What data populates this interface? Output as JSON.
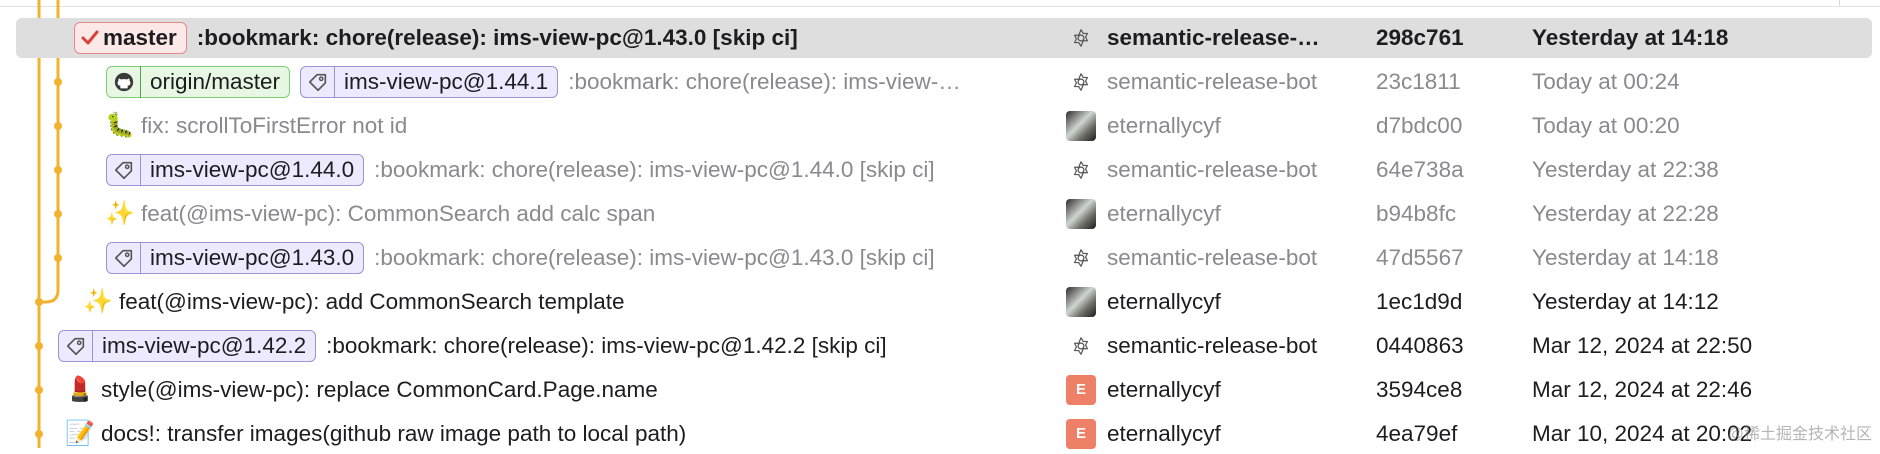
{
  "colors": {
    "graph_main": "#f2b22e",
    "graph_branch": "#f2b22e",
    "head_dot": "#2f7be0",
    "tag_border": "#9c92d6",
    "remote_border": "#7fcf74",
    "head_border": "#e38a8a",
    "selected_row": "#dedede"
  },
  "commits": [
    {
      "refs": [
        {
          "kind": "head",
          "icon": "checkmark-icon",
          "label": "master"
        }
      ],
      "emoji": "",
      "subject": ":bookmark: chore(release): ims-view-pc@1.43.0 [skip ci]",
      "author": "semantic-release-…",
      "avatar": "bot-icon",
      "hash": "298c761",
      "date": "Yesterday at 14:18",
      "selected": true,
      "dim": false,
      "indent": 58
    },
    {
      "refs": [
        {
          "kind": "remote",
          "icon": "github-icon",
          "label": "origin/master"
        },
        {
          "kind": "tag",
          "icon": "tag-icon",
          "label": "ims-view-pc@1.44.1"
        }
      ],
      "emoji": "",
      "subject": ":bookmark: chore(release): ims-view-…",
      "author": "semantic-release-bot",
      "avatar": "bot-icon",
      "hash": "23c1811",
      "date": "Today at 00:24",
      "selected": false,
      "dim": true,
      "indent": 90
    },
    {
      "refs": [],
      "emoji": "🐛",
      "subject": "fix: scrollToFirstError not id",
      "author": "eternallycyf",
      "avatar": "photo",
      "hash": "d7bdc00",
      "date": "Today at 00:20",
      "selected": false,
      "dim": true,
      "indent": 90
    },
    {
      "refs": [
        {
          "kind": "tag",
          "icon": "tag-icon",
          "label": "ims-view-pc@1.44.0"
        }
      ],
      "emoji": "",
      "subject": ":bookmark: chore(release): ims-view-pc@1.44.0 [skip ci]",
      "author": "semantic-release-bot",
      "avatar": "bot-icon",
      "hash": "64e738a",
      "date": "Yesterday at 22:38",
      "selected": false,
      "dim": true,
      "indent": 90
    },
    {
      "refs": [],
      "emoji": "✨",
      "subject": "feat(@ims-view-pc): CommonSearch add calc span",
      "author": "eternallycyf",
      "avatar": "photo",
      "hash": "b94b8fc",
      "date": "Yesterday at 22:28",
      "selected": false,
      "dim": true,
      "indent": 90
    },
    {
      "refs": [
        {
          "kind": "tag",
          "icon": "tag-icon",
          "label": "ims-view-pc@1.43.0"
        }
      ],
      "emoji": "",
      "subject": ":bookmark: chore(release): ims-view-pc@1.43.0 [skip ci]",
      "author": "semantic-release-bot",
      "avatar": "bot-icon",
      "hash": "47d5567",
      "date": "Yesterday at 14:18",
      "selected": false,
      "dim": true,
      "indent": 90
    },
    {
      "refs": [],
      "emoji": "✨",
      "subject": "feat(@ims-view-pc): add CommonSearch template",
      "author": "eternallycyf",
      "avatar": "photo",
      "hash": "1ec1d9d",
      "date": "Yesterday at 14:12",
      "selected": false,
      "dim": false,
      "indent": 68
    },
    {
      "refs": [
        {
          "kind": "tag",
          "icon": "tag-icon",
          "label": "ims-view-pc@1.42.2"
        }
      ],
      "emoji": "",
      "subject": ":bookmark: chore(release): ims-view-pc@1.42.2 [skip ci]",
      "author": "semantic-release-bot",
      "avatar": "bot-icon",
      "hash": "0440863",
      "date": "Mar 12, 2024 at 22:50",
      "selected": false,
      "dim": false,
      "indent": 42
    },
    {
      "refs": [],
      "emoji": "💄",
      "subject": "style(@ims-view-pc): replace CommonCard.Page.name",
      "author": "eternallycyf",
      "avatar": "letter",
      "avatar_letter": "E",
      "hash": "3594ce8",
      "date": "Mar 12, 2024 at 22:46",
      "selected": false,
      "dim": false,
      "indent": 50
    },
    {
      "refs": [],
      "emoji": "📝",
      "subject": "docs!: transfer images(github raw image path to local path)",
      "author": "eternallycyf",
      "avatar": "letter",
      "avatar_letter": "E",
      "hash": "4ea79ef",
      "date": "Mar 10, 2024 at 20:02",
      "selected": false,
      "dim": false,
      "indent": 50
    }
  ],
  "watermark": "@稀土掘金技术社区"
}
